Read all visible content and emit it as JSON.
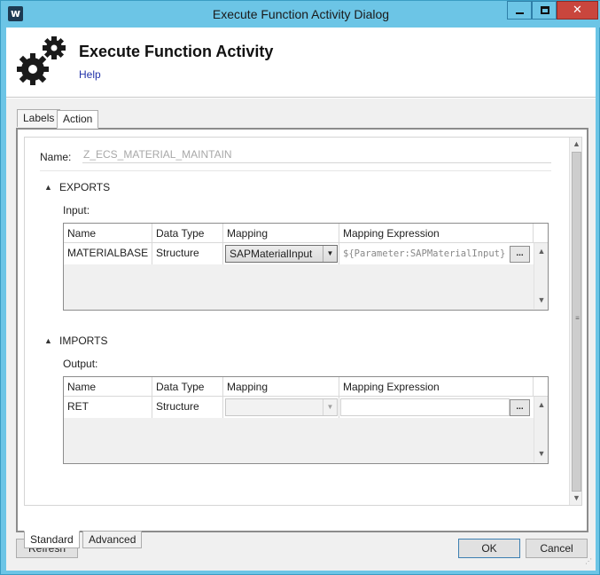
{
  "window": {
    "title": "Execute Function Activity Dialog",
    "app_icon_letter": "w",
    "close_glyph": "✕"
  },
  "header": {
    "title": "Execute Function Activity",
    "help_link": "Help"
  },
  "top_tabs": [
    {
      "label": "Labels",
      "selected": false
    },
    {
      "label": "Action",
      "selected": true
    }
  ],
  "form": {
    "name_label": "Name:",
    "name_value": "Z_ECS_MATERIAL_MAINTAIN"
  },
  "exports": {
    "section_label": "EXPORTS",
    "toggle_glyph": "▲",
    "sub_label": "Input:",
    "columns": [
      "Name",
      "Data Type",
      "Mapping",
      "Mapping Expression"
    ],
    "rows": [
      {
        "name": "MATERIALBASE",
        "data_type": "Structure",
        "mapping": "SAPMaterialInput",
        "expression": "${Parameter:SAPMaterialInput}",
        "button": "..."
      }
    ]
  },
  "imports": {
    "section_label": "IMPORTS",
    "toggle_glyph": "▲",
    "sub_label": "Output:",
    "columns": [
      "Name",
      "Data Type",
      "Mapping",
      "Mapping Expression"
    ],
    "rows": [
      {
        "name": "RET",
        "data_type": "Structure",
        "mapping": "",
        "expression": "",
        "button": "..."
      }
    ]
  },
  "bottom_tabs": [
    {
      "label": "Standard",
      "selected": true
    },
    {
      "label": "Advanced",
      "selected": false
    }
  ],
  "footer": {
    "refresh": "Refresh",
    "ok": "OK",
    "cancel": "Cancel"
  },
  "glyphs": {
    "up_arrow": "▲",
    "down_arrow": "▼",
    "dropdown_arrow": "▼",
    "grip": "≡"
  },
  "colors": {
    "window_frame": "#6cc5e6",
    "close_button": "#c9463d",
    "help_link": "#2233aa"
  }
}
